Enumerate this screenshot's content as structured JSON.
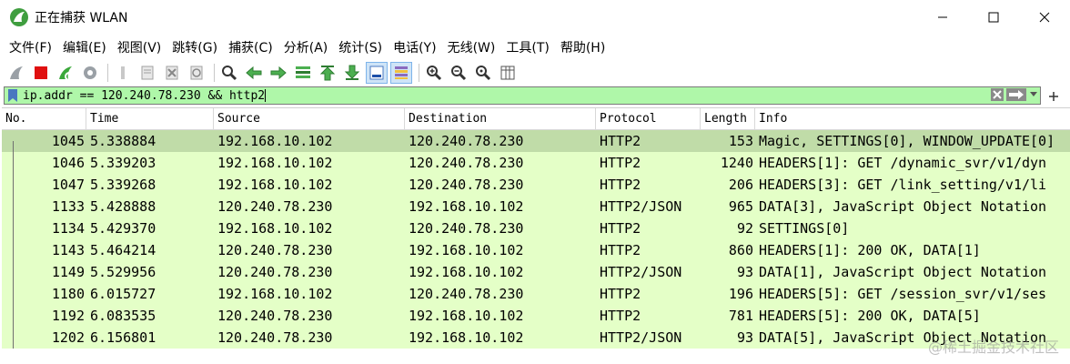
{
  "window": {
    "title": "正在捕获 WLAN",
    "icon": "wireshark-shark-fin-icon"
  },
  "menu": [
    {
      "label": "文件(F)"
    },
    {
      "label": "编辑(E)"
    },
    {
      "label": "视图(V)"
    },
    {
      "label": "跳转(G)"
    },
    {
      "label": "捕获(C)"
    },
    {
      "label": "分析(A)"
    },
    {
      "label": "统计(S)"
    },
    {
      "label": "电话(Y)"
    },
    {
      "label": "无线(W)"
    },
    {
      "label": "工具(T)"
    },
    {
      "label": "帮助(H)"
    }
  ],
  "toolbar": {
    "icons": [
      "start-capture-icon",
      "stop-capture-icon",
      "restart-capture-icon",
      "capture-options-icon",
      "open-file-icon",
      "save-file-icon",
      "close-file-icon",
      "reload-file-icon",
      "find-packet-icon",
      "go-back-icon",
      "go-forward-icon",
      "go-to-packet-icon",
      "first-packet-icon",
      "last-packet-icon",
      "auto-scroll-icon",
      "colorize-icon",
      "zoom-in-icon",
      "zoom-out-icon",
      "normal-size-icon",
      "resize-columns-icon"
    ]
  },
  "filter": {
    "value": "ip.addr == 120.240.78.230 && http2",
    "background": "#aff7a9"
  },
  "columns": {
    "no": "No.",
    "time": "Time",
    "source": "Source",
    "destination": "Destination",
    "protocol": "Protocol",
    "length": "Length",
    "info": "Info"
  },
  "packets": [
    {
      "no": "1045",
      "time": "5.338884",
      "source": "192.168.10.102",
      "destination": "120.240.78.230",
      "protocol": "HTTP2",
      "length": "153",
      "info": "Magic, SETTINGS[0], WINDOW_UPDATE[0]"
    },
    {
      "no": "1046",
      "time": "5.339203",
      "source": "192.168.10.102",
      "destination": "120.240.78.230",
      "protocol": "HTTP2",
      "length": "1240",
      "info": "HEADERS[1]: GET /dynamic_svr/v1/dyn"
    },
    {
      "no": "1047",
      "time": "5.339268",
      "source": "192.168.10.102",
      "destination": "120.240.78.230",
      "protocol": "HTTP2",
      "length": "206",
      "info": "HEADERS[3]: GET /link_setting/v1/li"
    },
    {
      "no": "1133",
      "time": "5.428888",
      "source": "120.240.78.230",
      "destination": "192.168.10.102",
      "protocol": "HTTP2/JSON",
      "length": "965",
      "info": "DATA[3], JavaScript Object Notation"
    },
    {
      "no": "1134",
      "time": "5.429370",
      "source": "192.168.10.102",
      "destination": "120.240.78.230",
      "protocol": "HTTP2",
      "length": "92",
      "info": "SETTINGS[0]"
    },
    {
      "no": "1143",
      "time": "5.464214",
      "source": "120.240.78.230",
      "destination": "192.168.10.102",
      "protocol": "HTTP2",
      "length": "860",
      "info": "HEADERS[1]: 200 OK, DATA[1]"
    },
    {
      "no": "1149",
      "time": "5.529956",
      "source": "120.240.78.230",
      "destination": "192.168.10.102",
      "protocol": "HTTP2/JSON",
      "length": "93",
      "info": "DATA[1], JavaScript Object Notation"
    },
    {
      "no": "1180",
      "time": "6.015727",
      "source": "192.168.10.102",
      "destination": "120.240.78.230",
      "protocol": "HTTP2",
      "length": "196",
      "info": "HEADERS[5]: GET /session_svr/v1/ses"
    },
    {
      "no": "1192",
      "time": "6.083535",
      "source": "120.240.78.230",
      "destination": "192.168.10.102",
      "protocol": "HTTP2",
      "length": "781",
      "info": "HEADERS[5]: 200 OK, DATA[5]"
    },
    {
      "no": "1202",
      "time": "6.156801",
      "source": "120.240.78.230",
      "destination": "192.168.10.102",
      "protocol": "HTTP2/JSON",
      "length": "93",
      "info": "DATA[5], JavaScript Object Notation"
    }
  ],
  "colors": {
    "row_background": "#e4ffc7",
    "selected_row_background": "#c0dca8"
  },
  "watermark": "@稀土掘金技术社区"
}
